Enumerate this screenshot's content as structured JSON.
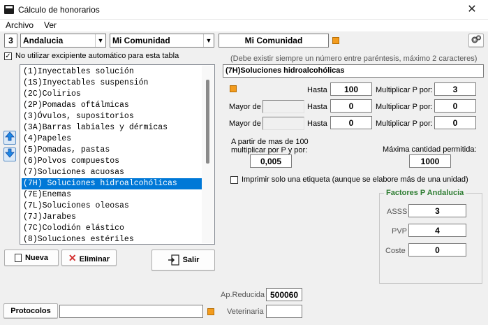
{
  "window": {
    "title": "Cálculo de honorarios",
    "close": "✕"
  },
  "menu": {
    "archivo": "Archivo",
    "ver": "Ver"
  },
  "header": {
    "region_code": "3",
    "region_value": "Andalucia",
    "scope_value": "Mi Comunidad",
    "scope_display": "Mi Comunidad",
    "colors": {
      "orange": "#f39c1e"
    }
  },
  "left": {
    "checkbox_label": "No utilizar excipiente automático para esta tabla",
    "checkbox_checked": "✓",
    "items": [
      "(1)Inyectables solución",
      "(1S)Inyectables suspensión",
      "(2C)Colirios",
      "(2P)Pomadas oftálmicas",
      "(3)Óvulos, supositorios",
      "(3A)Barras labiales y dérmicas",
      "(4)Papeles",
      "(5)Pomadas, pastas",
      "(6)Polvos compuestos",
      "(7)Soluciones acuosas",
      "(7H) Soluciones hidroalcohólicas",
      "(7E)Enemas",
      "(7L)Soluciones oleosas",
      "(7J)Jarabes",
      "(7C)Colodión elástico",
      "(8)Soluciones estériles"
    ],
    "selected_index": 10,
    "nueva": "Nueva",
    "eliminar": "Eliminar",
    "salir": "Salir"
  },
  "right": {
    "note": "(Debe existir siempre un número entre paréntesis, máximo 2 caracteres)",
    "name_value": "(7H)Soluciones hidroalcohólicas",
    "rows": [
      {
        "mayor_label": "",
        "hasta_label": "Hasta",
        "hasta": "100",
        "mult_label": "Multiplicar P por:",
        "mult": "3"
      },
      {
        "mayor_label": "Mayor de",
        "hasta_label": "Hasta",
        "hasta": "0",
        "mult_label": "Multiplicar P por:",
        "mult": "0"
      },
      {
        "mayor_label": "Mayor de",
        "hasta_label": "Hasta",
        "hasta": "0",
        "mult_label": "Multiplicar P por:",
        "mult": "0"
      }
    ],
    "partir_label_1": "A partir de mas de 100",
    "partir_label_2": "multiplicar por P y por:",
    "partir_value": "0,005",
    "max_label": "Máxima cantidad permitida:",
    "max_value": "1000",
    "imprimir_label": "Imprimir solo una etiqueta (aunque se elabore más de una unidad)",
    "factores": {
      "title": "Factores P Andalucia",
      "asss_label": "ASSS",
      "asss": "3",
      "pvp_label": "PVP",
      "pvp": "4",
      "coste_label": "Coste",
      "coste": "0"
    }
  },
  "bottom": {
    "ap_reducida_label": "Ap.Reducida",
    "ap_reducida": "500060",
    "veterinaria_label": "Veterinaria",
    "veterinaria": "",
    "protocolos": "Protocolos",
    "protocolos_value": ""
  }
}
